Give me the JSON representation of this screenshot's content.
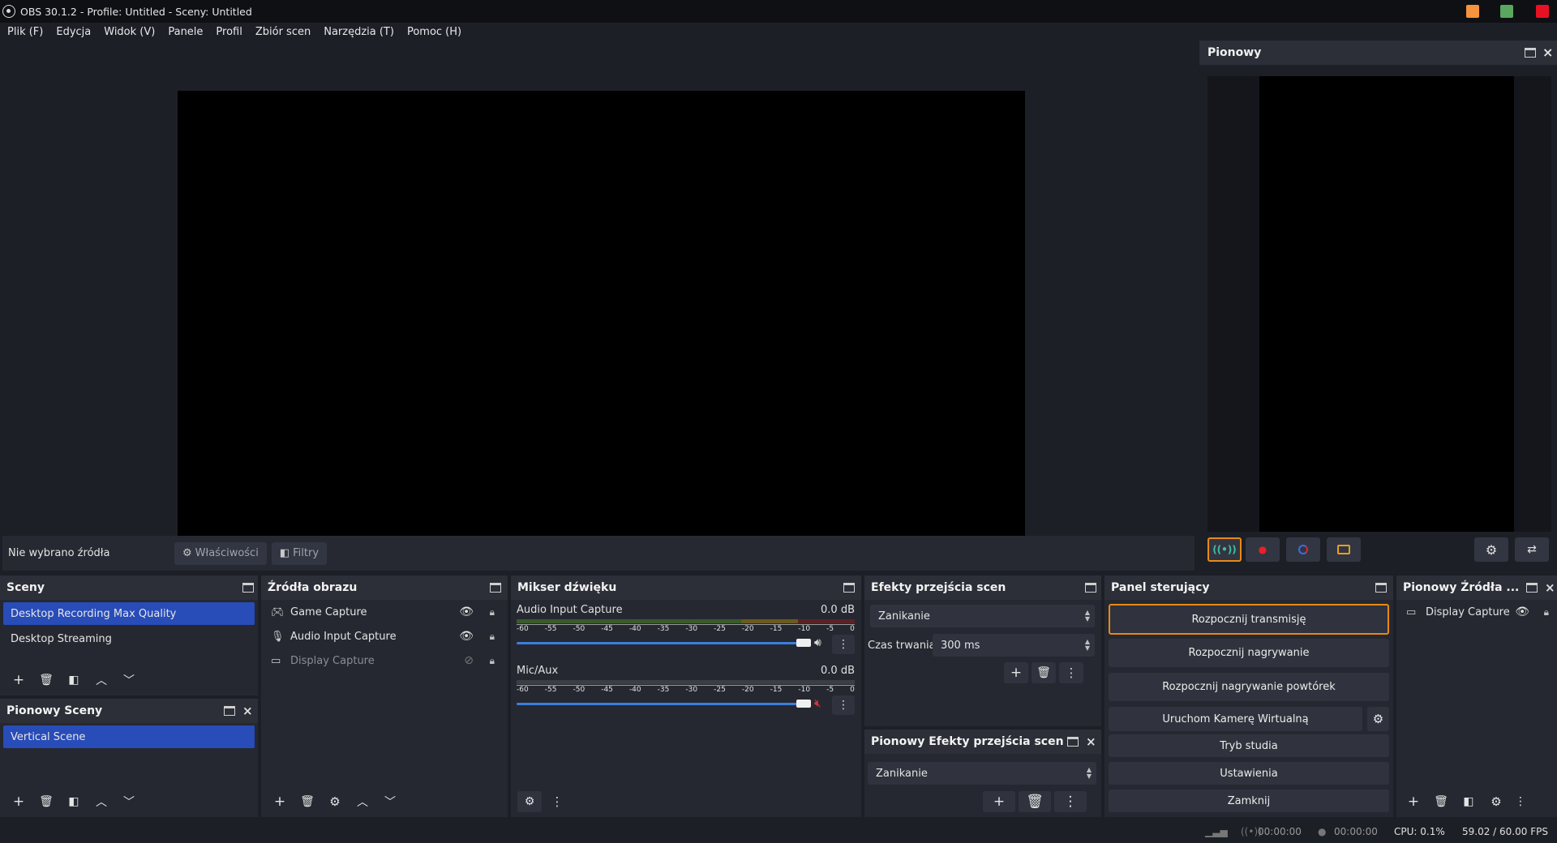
{
  "window": {
    "title": "OBS 30.1.2 - Profile: Untitled - Sceny: Untitled",
    "colors": {
      "minimize": "#f5923e",
      "maximize": "#5aa760",
      "close": "#e81123"
    }
  },
  "menu": [
    "Plik (F)",
    "Edycja",
    "Widok (V)",
    "Panele",
    "Profil",
    "Zbiór scen",
    "Narzędzia (T)",
    "Pomoc (H)"
  ],
  "source_toolbar": {
    "no_source": "Nie wybrano źródła",
    "properties": "Właściwości",
    "filters": "Filtry"
  },
  "vertical_dock": {
    "title": "Pionowy",
    "accent": "#e8891a"
  },
  "scenes": {
    "title": "Sceny",
    "items": [
      "Desktop Recording Max Quality",
      "Desktop Streaming"
    ],
    "selected": 0
  },
  "vertical_scenes": {
    "title": "Pionowy Sceny",
    "items": [
      "Vertical Scene"
    ]
  },
  "sources": {
    "title": "Źródła obrazu",
    "items": [
      {
        "name": "Game Capture",
        "icon": "gamepad-icon",
        "visible": true
      },
      {
        "name": "Audio Input Capture",
        "icon": "microphone-icon",
        "visible": true
      },
      {
        "name": "Display Capture",
        "icon": "monitor-icon",
        "visible": false
      }
    ]
  },
  "mixer": {
    "title": "Mikser dźwięku",
    "channels": [
      {
        "name": "Audio Input Capture",
        "db": "0.0 dB",
        "muted": false
      },
      {
        "name": "Mic/Aux",
        "db": "0.0 dB",
        "muted": true
      }
    ],
    "ticks": [
      "-60",
      "-55",
      "-50",
      "-45",
      "-40",
      "-35",
      "-30",
      "-25",
      "-20",
      "-15",
      "-10",
      "-5",
      "0"
    ]
  },
  "transitions": {
    "title": "Efekty przejścia scen",
    "selected": "Zanikanie",
    "duration_label": "Czas trwania",
    "duration_value": "300 ms"
  },
  "vertical_transitions": {
    "title": "Pionowy Efekty przejścia scen",
    "selected": "Zanikanie"
  },
  "controls": {
    "title": "Panel sterujący",
    "start_stream": "Rozpocznij transmisję",
    "start_record": "Rozpocznij nagrywanie",
    "start_replay": "Rozpocznij nagrywanie powtórek",
    "virtual_cam": "Uruchom Kamerę Wirtualną",
    "studio_mode": "Tryb studia",
    "settings": "Ustawienia",
    "exit": "Zamknij"
  },
  "vertical_sources": {
    "title": "Pionowy Źródła ...",
    "items": [
      "Display Capture"
    ]
  },
  "status": {
    "stream_time": "00:00:00",
    "record_time": "00:00:00",
    "cpu": "CPU: 0.1%",
    "fps": "59.02 / 60.00 FPS"
  }
}
